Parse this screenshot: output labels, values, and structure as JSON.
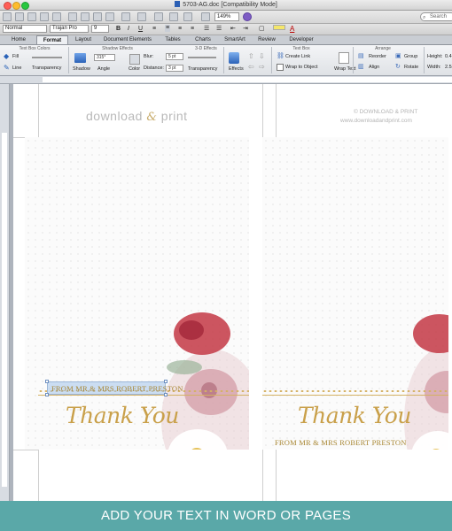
{
  "window": {
    "title": "5703-AG.doc [Compatibility Mode]"
  },
  "toolbar": {
    "zoom": "149%",
    "search_placeholder": "Search"
  },
  "formatting": {
    "style": "Normal",
    "font": "Trajan Pro",
    "size": "9"
  },
  "ribbon_tabs": [
    "Home",
    "Format",
    "Layout",
    "Document Elements",
    "Tables",
    "Charts",
    "SmartArt",
    "Review",
    "Developer"
  ],
  "ribbon": {
    "groups": {
      "text_box_colors": "Text Box Colors",
      "shadow_effects": "Shadow Effects",
      "three_d_effects": "3-D Effects",
      "text_box": "Text Box",
      "arrange": "Arrange"
    },
    "fill": "Fill",
    "line": "Line",
    "transparency": "Transparency",
    "shadow": "Shadow",
    "angle": "Angle",
    "angle_value": "315°",
    "color": "Color",
    "blur": "Blur:",
    "blur_value": "5 pt",
    "distance": "Distance:",
    "distance_value": "3 pt",
    "transparency2": "Transparency",
    "effects": "Effects",
    "create_link": "Create Link",
    "wrap_text": "Wrap Text",
    "wrap_to_object": "Wrap to Object",
    "reorder": "Reorder",
    "align": "Align",
    "group": "Group",
    "rotate": "Rotate",
    "height_label": "Height:",
    "height_value": "0.4",
    "width_label": "Width:",
    "width_value": "2.5"
  },
  "document": {
    "logo_left": "download",
    "logo_amp": "&",
    "logo_right": "print",
    "copyright_line1": "© DOWNLOAD & PRINT",
    "copyright_line2": "www.downloadandprint.com",
    "cards": [
      {
        "thank_you": "Thank You",
        "from": "FROM MR & MRS ROBERT PRESTON"
      },
      {
        "thank_you": "Thank You",
        "from": "FROM MR & MRS ROBERT PRESTON"
      }
    ]
  },
  "caption": "ADD YOUR TEXT IN WORD OR PAGES"
}
